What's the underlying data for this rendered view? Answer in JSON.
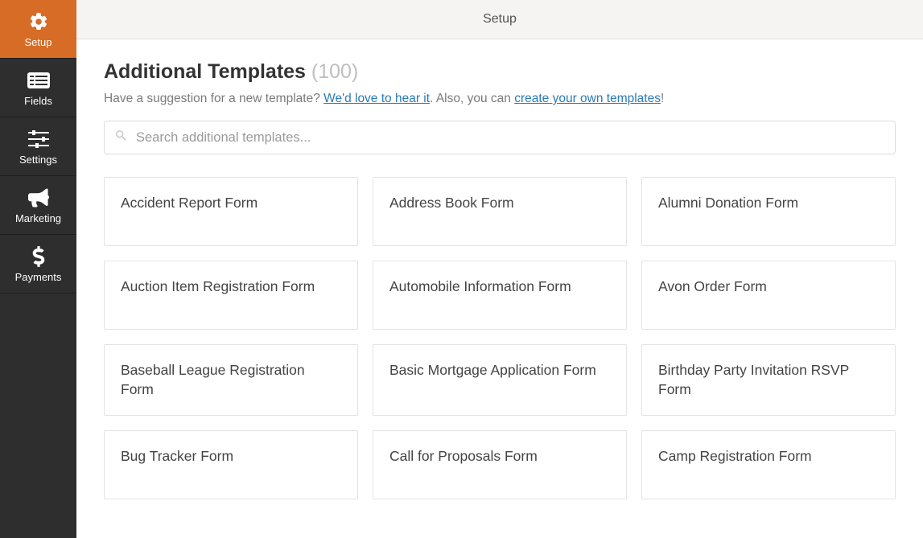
{
  "sidebar": {
    "items": [
      {
        "label": "Setup"
      },
      {
        "label": "Fields"
      },
      {
        "label": "Settings"
      },
      {
        "label": "Marketing"
      },
      {
        "label": "Payments"
      }
    ]
  },
  "header": {
    "title": "Setup"
  },
  "page": {
    "title": "Additional Templates",
    "count": "(100)",
    "suggestion_prefix": "Have a suggestion for a new template? ",
    "suggestion_link1": "We'd love to hear it",
    "suggestion_middle": ". Also, you can ",
    "suggestion_link2": "create your own templates",
    "suggestion_suffix": "!"
  },
  "search": {
    "placeholder": "Search additional templates..."
  },
  "templates": [
    {
      "name": "Accident Report Form"
    },
    {
      "name": "Address Book Form"
    },
    {
      "name": "Alumni Donation Form"
    },
    {
      "name": "Auction Item Registration Form"
    },
    {
      "name": "Automobile Information Form"
    },
    {
      "name": "Avon Order Form"
    },
    {
      "name": "Baseball League Registration Form"
    },
    {
      "name": "Basic Mortgage Application Form"
    },
    {
      "name": "Birthday Party Invitation RSVP Form"
    },
    {
      "name": "Bug Tracker Form"
    },
    {
      "name": "Call for Proposals Form"
    },
    {
      "name": "Camp Registration Form"
    }
  ]
}
